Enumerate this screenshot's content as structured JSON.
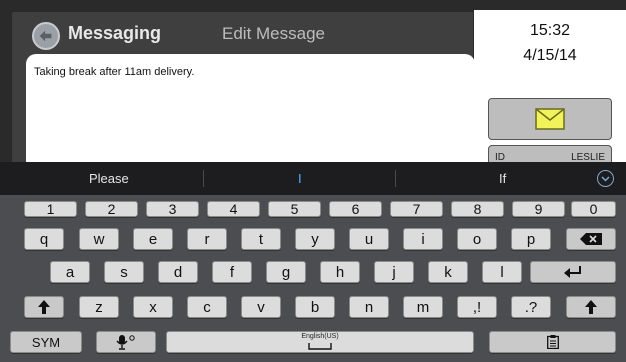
{
  "app": {
    "title": "Messaging",
    "screen_title": "Edit Message"
  },
  "message": {
    "text": "Taking break after 11am delivery."
  },
  "status": {
    "time": "15:32",
    "date": "4/15/14"
  },
  "partial_button": {
    "left": "ID",
    "right": "LESLIE"
  },
  "suggestions": [
    "Please",
    "I",
    "If"
  ],
  "keyboard": {
    "number_row": [
      "1",
      "2",
      "3",
      "4",
      "5",
      "6",
      "7",
      "8",
      "9",
      "0"
    ],
    "row1": [
      "q",
      "w",
      "e",
      "r",
      "t",
      "y",
      "u",
      "i",
      "o",
      "p"
    ],
    "row2": [
      "a",
      "s",
      "d",
      "f",
      "g",
      "h",
      "j",
      "k",
      "l"
    ],
    "row3": [
      "z",
      "x",
      "c",
      "v",
      "b",
      "n",
      "m",
      ",!",
      ".?"
    ],
    "sym_label": "SYM",
    "space_label": "English(US)"
  },
  "colors": {
    "accent": "#4fb3ff",
    "key": "#dcdcdc",
    "keyboard_bg": "#4b4d50"
  }
}
